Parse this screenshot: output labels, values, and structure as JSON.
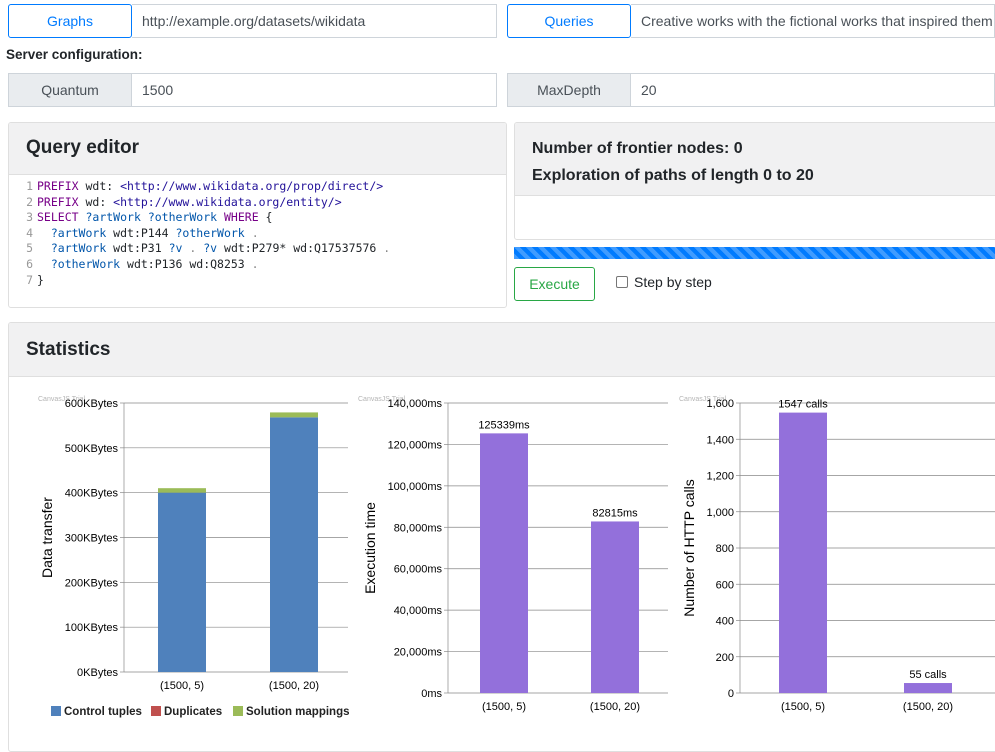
{
  "top": {
    "graphs_button": "Graphs",
    "graphs_value": "http://example.org/datasets/wikidata",
    "queries_button": "Queries",
    "queries_value": "Creative works with the fictional works that inspired them"
  },
  "server_config": {
    "heading": "Server configuration:",
    "quantum_label": "Quantum",
    "quantum_value": "1500",
    "maxdepth_label": "MaxDepth",
    "maxdepth_value": "20"
  },
  "query_editor": {
    "title": "Query editor",
    "lines": [
      "1",
      "2",
      "3",
      "4",
      "5",
      "6",
      "7"
    ]
  },
  "exploration": {
    "frontier": "Number of frontier nodes: 0",
    "paths": "Exploration of paths of length 0 to 20",
    "execute_label": "Execute",
    "step_label": "Step by step"
  },
  "statistics": {
    "title": "Statistics",
    "watermark": "CanvasJS Trial"
  },
  "colors": {
    "control": "#4f81bc",
    "duplicates": "#c0504e",
    "solution": "#9bbb58",
    "purple": "#9370db",
    "primary": "#007bff",
    "success": "#28a745"
  },
  "chart_data": [
    {
      "type": "bar",
      "stacked": true,
      "categories": [
        "(1500, 5)",
        "(1500, 20)"
      ],
      "series": [
        {
          "name": "Control tuples",
          "values": [
            400,
            568
          ]
        },
        {
          "name": "Duplicates",
          "values": [
            0,
            0
          ]
        },
        {
          "name": "Solution mappings",
          "values": [
            10,
            11
          ]
        }
      ],
      "ylabel": "Data transfer",
      "ylim": [
        0,
        600
      ],
      "yticks": [
        "0KBytes",
        "100KBytes",
        "200KBytes",
        "300KBytes",
        "400KBytes",
        "500KBytes",
        "600KBytes"
      ],
      "grid": true,
      "legend": "bottom"
    },
    {
      "type": "bar",
      "categories": [
        "(1500, 5)",
        "(1500, 20)"
      ],
      "values": [
        125339,
        82815
      ],
      "data_labels": [
        "125339ms",
        "82815ms"
      ],
      "ylabel": "Execution time",
      "ylim": [
        0,
        140000
      ],
      "yticks": [
        "0ms",
        "20,000ms",
        "40,000ms",
        "60,000ms",
        "80,000ms",
        "100,000ms",
        "120,000ms",
        "140,000ms"
      ],
      "grid": true
    },
    {
      "type": "bar",
      "categories": [
        "(1500, 5)",
        "(1500, 20)"
      ],
      "values": [
        1547,
        55
      ],
      "data_labels": [
        "1547 calls",
        "55 calls"
      ],
      "ylabel": "Number of HTTP calls",
      "ylim": [
        0,
        1600
      ],
      "yticks": [
        "0",
        "200",
        "400",
        "600",
        "800",
        "1,000",
        "1,200",
        "1,400",
        "1,600"
      ],
      "grid": true
    }
  ]
}
